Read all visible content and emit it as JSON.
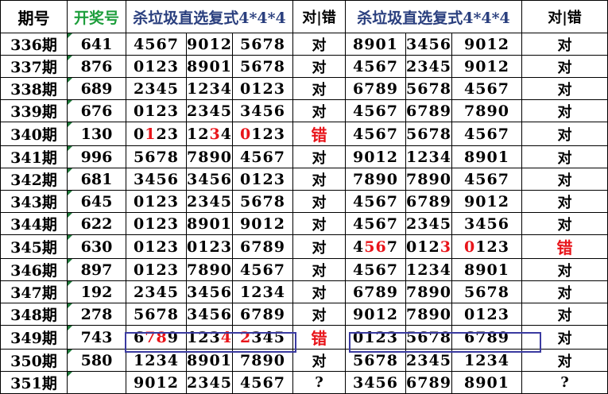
{
  "header": {
    "issue": "期号",
    "draw": "开奖号",
    "group_a_title": "杀垃圾直选复式4*4*4",
    "group_a_result": "对|错",
    "group_b_title": "杀垃圾直选复式4*4*4",
    "group_b_result": "对|错"
  },
  "rows": [
    {
      "issue": "336期",
      "draw": "641",
      "a": [
        "4567",
        "9012",
        "5678"
      ],
      "a_hit": [
        "",
        "1",
        "4"
      ],
      "a_res": "对",
      "b": [
        "8901",
        "3456",
        "9012"
      ],
      "b_res": "对"
    },
    {
      "issue": "337期",
      "draw": "876",
      "a": [
        "0123",
        "8901",
        "5678"
      ],
      "a_res": "对",
      "b": [
        "4567",
        "2345",
        "9012"
      ],
      "b_res": "对"
    },
    {
      "issue": "338期",
      "draw": "689",
      "a": [
        "2345",
        "1234",
        "0123"
      ],
      "a_res": "对",
      "b": [
        "6789",
        "5678",
        "4567"
      ],
      "b_res": "对"
    },
    {
      "issue": "339期",
      "draw": "676",
      "a": [
        "0123",
        "2345",
        "3456"
      ],
      "a_res": "对",
      "b": [
        "4567",
        "6789",
        "7890"
      ],
      "b_res": "对"
    },
    {
      "issue": "340期",
      "draw": "130",
      "a": [
        "0123",
        "1234",
        "0123"
      ],
      "a_res": "错",
      "b": [
        "4567",
        "5678",
        "4567"
      ],
      "b_res": "对"
    },
    {
      "issue": "341期",
      "draw": "996",
      "a": [
        "5678",
        "7890",
        "4567"
      ],
      "a_res": "对",
      "b": [
        "9012",
        "1234",
        "8901"
      ],
      "b_res": "对"
    },
    {
      "issue": "342期",
      "draw": "681",
      "a": [
        "3456",
        "3456",
        "0123"
      ],
      "a_res": "对",
      "b": [
        "7890",
        "7890",
        "4567"
      ],
      "b_res": "对"
    },
    {
      "issue": "343期",
      "draw": "645",
      "a": [
        "0123",
        "2345",
        "5678"
      ],
      "a_res": "对",
      "b": [
        "4567",
        "6789",
        "9012"
      ],
      "b_res": "对"
    },
    {
      "issue": "344期",
      "draw": "622",
      "a": [
        "0123",
        "8901",
        "9012"
      ],
      "a_res": "对",
      "b": [
        "4567",
        "2345",
        "3456"
      ],
      "b_res": "对"
    },
    {
      "issue": "345期",
      "draw": "630",
      "a": [
        "0123",
        "0123",
        "6789"
      ],
      "a_res": "对",
      "b": [
        "4567",
        "0123",
        "0123"
      ],
      "b_res": "错"
    },
    {
      "issue": "346期",
      "draw": "897",
      "a": [
        "0123",
        "7890",
        "4567"
      ],
      "a_res": "对",
      "b": [
        "4567",
        "1234",
        "8901"
      ],
      "b_res": "对"
    },
    {
      "issue": "347期",
      "draw": "192",
      "a": [
        "2345",
        "3456",
        "1234"
      ],
      "a_res": "对",
      "b": [
        "6789",
        "7890",
        "5678"
      ],
      "b_res": "对"
    },
    {
      "issue": "348期",
      "draw": "278",
      "a": [
        "5678",
        "3456",
        "6789"
      ],
      "a_res": "对",
      "b": [
        "9012",
        "7890",
        "0123"
      ],
      "b_res": "对"
    },
    {
      "issue": "349期",
      "draw": "743",
      "a": [
        "6789",
        "1234",
        "2345"
      ],
      "a_res": "错",
      "b": [
        "0123",
        "5678",
        "6789"
      ],
      "b_res": "对"
    },
    {
      "issue": "350期",
      "draw": "580",
      "a": [
        "1234",
        "8901",
        "7890"
      ],
      "a_res": "对",
      "b": [
        "5678",
        "2345",
        "1234"
      ],
      "b_res": "对"
    },
    {
      "issue": "351期",
      "draw": "",
      "a": [
        "9012",
        "2345",
        "4567"
      ],
      "a_res": "?",
      "b": [
        "3456",
        "6789",
        "8901"
      ],
      "b_res": "?"
    }
  ],
  "highlights": {
    "340": {
      "a": [
        [
          1
        ],
        [
          2
        ],
        [
          0
        ]
      ]
    },
    "345": {
      "b": [
        [
          1,
          2
        ],
        [
          3
        ],
        [
          0
        ]
      ]
    },
    "349": {
      "a": [
        [
          1,
          2
        ],
        [
          3
        ],
        [
          0
        ]
      ]
    }
  },
  "colors": {
    "draw_header": "#1d9e3c",
    "title_header": "#2a3f7e",
    "miss": "#e8141a",
    "box": "#3a3aa0"
  }
}
